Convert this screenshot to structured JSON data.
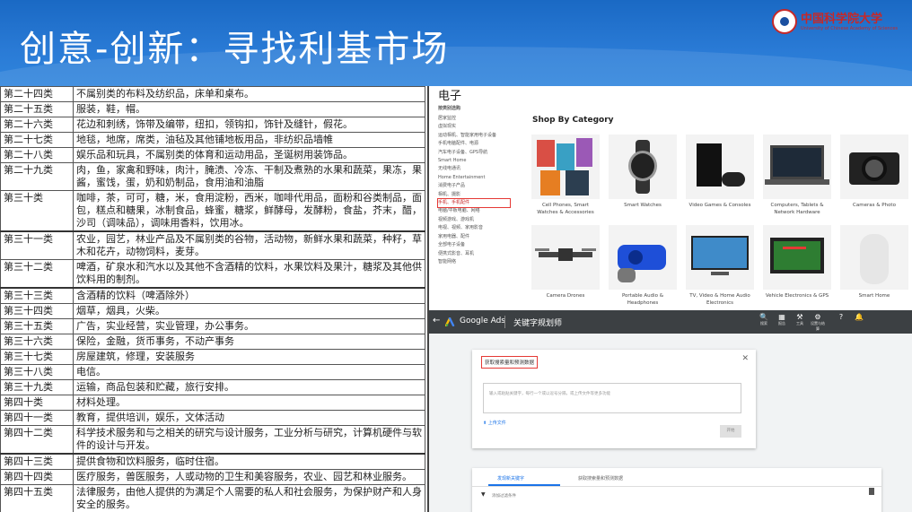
{
  "slide": {
    "title": "创意-创新：寻找利基市场",
    "logo_cn": "中国科学院大学",
    "logo_en": "University of Chinese Academy of Sciences"
  },
  "table": {
    "rows": [
      {
        "cls": "第二十四类",
        "desc": "不属别类的布料及纺织品，床单和桌布。"
      },
      {
        "cls": "第二十五类",
        "desc": "服装，鞋，帽。"
      },
      {
        "cls": "第二十六类",
        "desc": "花边和刺绣，饰带及编带，纽扣，领钩扣，饰针及缝针，假花。"
      },
      {
        "cls": "第二十七类",
        "desc": "地毯，地席，席类，油毡及其他铺地板用品，非纺织品墙帷"
      },
      {
        "cls": "第二十八类",
        "desc": "娱乐品和玩具，不属别类的体育和运动用品，圣诞树用装饰品。"
      },
      {
        "cls": "第二十九类",
        "desc": "肉，鱼，家禽和野味，肉汁，腌渍、冷冻、干制及煮熟的水果和蔬菜，果冻，果酱，蜜饯，蛋，奶和奶制品，食用油和油脂"
      },
      {
        "cls": "第三十类",
        "desc": "咖啡，茶，可可，糖，米，食用淀粉，西米，咖啡代用品，面粉和谷类制品，面包，糕点和糖果，冰制食品，蜂蜜，糖浆，鲜酵母，发酵粉，食盐，芥末，醋，沙司（调味品），调味用香料，饮用冰。"
      },
      {
        "cls": "第三十一类",
        "desc": "农业，园艺，林业产品及不属别类的谷物，活动物，新鲜水果和蔬菜，种籽，草木和花卉，动物饲料，麦芽。"
      },
      {
        "cls": "第三十二类",
        "desc": "啤酒，矿泉水和汽水以及其他不含酒精的饮料，水果饮料及果汁，糖浆及其他供饮料用的制剂。"
      },
      {
        "cls": "第三十三类",
        "desc": "含酒精的饮料（啤酒除外）"
      },
      {
        "cls": "第三十四类",
        "desc": "烟草，烟具，火柴。"
      },
      {
        "cls": "第三十五类",
        "desc": "广告，实业经营，实业管理，办公事务。"
      },
      {
        "cls": "第三十六类",
        "desc": "保险，金融，货币事务，不动产事务"
      },
      {
        "cls": "第三十七类",
        "desc": "房屋建筑，修理，安装服务"
      },
      {
        "cls": "第三十八类",
        "desc": "电信。"
      },
      {
        "cls": "第三十九类",
        "desc": "运输，商品包装和贮藏，旅行安排。"
      },
      {
        "cls": "第四十类",
        "desc": "材料处理。"
      },
      {
        "cls": "第四十一类",
        "desc": "教育，提供培训，娱乐，文体活动"
      },
      {
        "cls": "第四十二类",
        "desc": "科学技术服务和与之相关的研究与设计服务，工业分析与研究，计算机硬件与软件的设计与开发。"
      },
      {
        "cls": "第四十三类",
        "desc": "提供食物和饮料服务，临时住宿。"
      },
      {
        "cls": "第四十四类",
        "desc": "医疗服务，兽医服务，人或动物的卫生和美容服务，农业、园艺和林业服务。"
      },
      {
        "cls": "第四十五类",
        "desc": "法律服务，由他人提供的为满足个人需要的私人和社会服务，为保护财产和人身安全的服务。"
      }
    ]
  },
  "shop": {
    "heading": "电子",
    "sidebar_heading": "按类别选购",
    "sidebar_items": [
      "居家监控",
      "虚拟现实",
      "运动相机、智能家用电子设备",
      "手机电脑配件、电源",
      "汽车电子设备、GPS导航",
      "Smart Home",
      "无线电通讯",
      "Home Entertainment",
      "消费电子产品",
      "相机、摄影",
      "手机、手机配件",
      "电脑/平板电脑、网络",
      "视频游戏、游戏机",
      "电视、视频、家用影音",
      "家用电器、配件",
      "全部电子设备",
      "便携式影音、耳机",
      "智能网络"
    ],
    "highlight_index": 10,
    "category_title": "Shop By Category",
    "tiles": [
      {
        "label": "Cell Phones, Smart Watches & Accessories"
      },
      {
        "label": "Smart Watches"
      },
      {
        "label": "Video Games & Consoles"
      },
      {
        "label": "Computers, Tablets & Network Hardware"
      },
      {
        "label": "Cameras & Photo"
      },
      {
        "label": "Camera Drones"
      },
      {
        "label": "Portable Audio & Headphones"
      },
      {
        "label": "TV, Video & Home Audio Electronics"
      },
      {
        "label": "Vehicle Electronics & GPS"
      },
      {
        "label": "Smart Home"
      }
    ]
  },
  "ads": {
    "app_name": "Google Ads",
    "tool_name": "关键字规划师",
    "toolbar": [
      {
        "icon": "search-icon",
        "label": "搜索"
      },
      {
        "icon": "reports-icon",
        "label": "报告"
      },
      {
        "icon": "tools-icon",
        "label": "工具"
      },
      {
        "icon": "settings-icon",
        "label": "设置与结算"
      },
      {
        "icon": "help-icon",
        "label": ""
      },
      {
        "icon": "notification-icon",
        "label": ""
      }
    ],
    "dialog_title": "获取搜索量和预测数据",
    "dialog_placeholder": "输入或粘贴关键字，每行一个或以逗号分隔，或上传文件等更多功能",
    "upload_label": "上传文件",
    "start_button": "开始",
    "tab_active": "发现新关键字",
    "tab_other": "获取搜索量和预测数据",
    "filter_text": "添加过滤条件"
  }
}
